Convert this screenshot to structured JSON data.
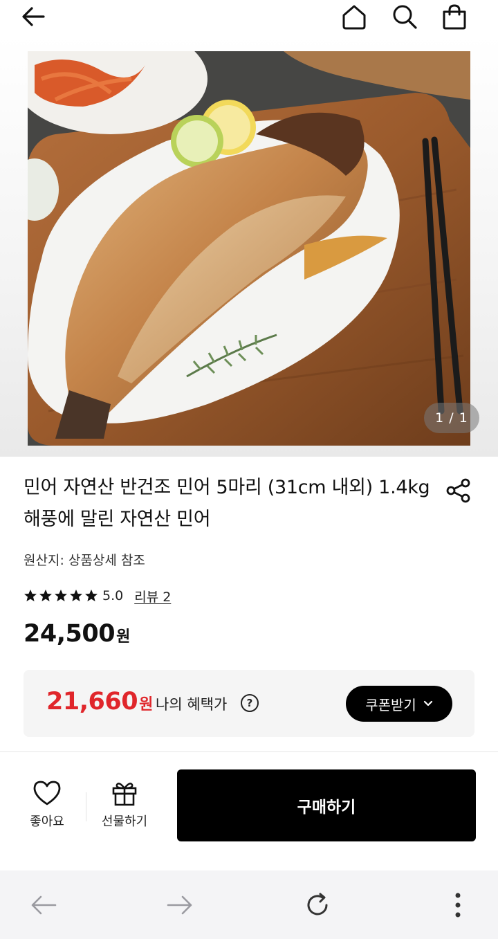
{
  "header": {
    "icons": [
      "back-arrow-icon",
      "home-icon",
      "search-icon",
      "shopping-bag-icon"
    ]
  },
  "product": {
    "image_counter": "1 / 1",
    "title": "민어 자연산 반건조 민어 5마리 (31cm 내외) 1.4kg 해풍에 말린 자연산 민어",
    "origin": "원산지: 상품상세 참조",
    "rating": {
      "stars": 5,
      "score": "5.0",
      "reviews_label": "리뷰 2"
    },
    "price": {
      "amount": "24,500",
      "unit": "원"
    },
    "benefit": {
      "amount": "21,660",
      "unit": "원",
      "label": "나의 혜택가",
      "help_glyph": "?",
      "coupon_button": "쿠폰받기",
      "colors": {
        "benefit_price": "#e0262b",
        "coupon_bg": "#000000"
      }
    }
  },
  "actions": {
    "like_label": "좋아요",
    "gift_label": "선물하기",
    "buy_label": "구매하기"
  },
  "browser_nav": {
    "icons": [
      "back-icon",
      "forward-icon",
      "reload-icon",
      "more-icon"
    ]
  }
}
